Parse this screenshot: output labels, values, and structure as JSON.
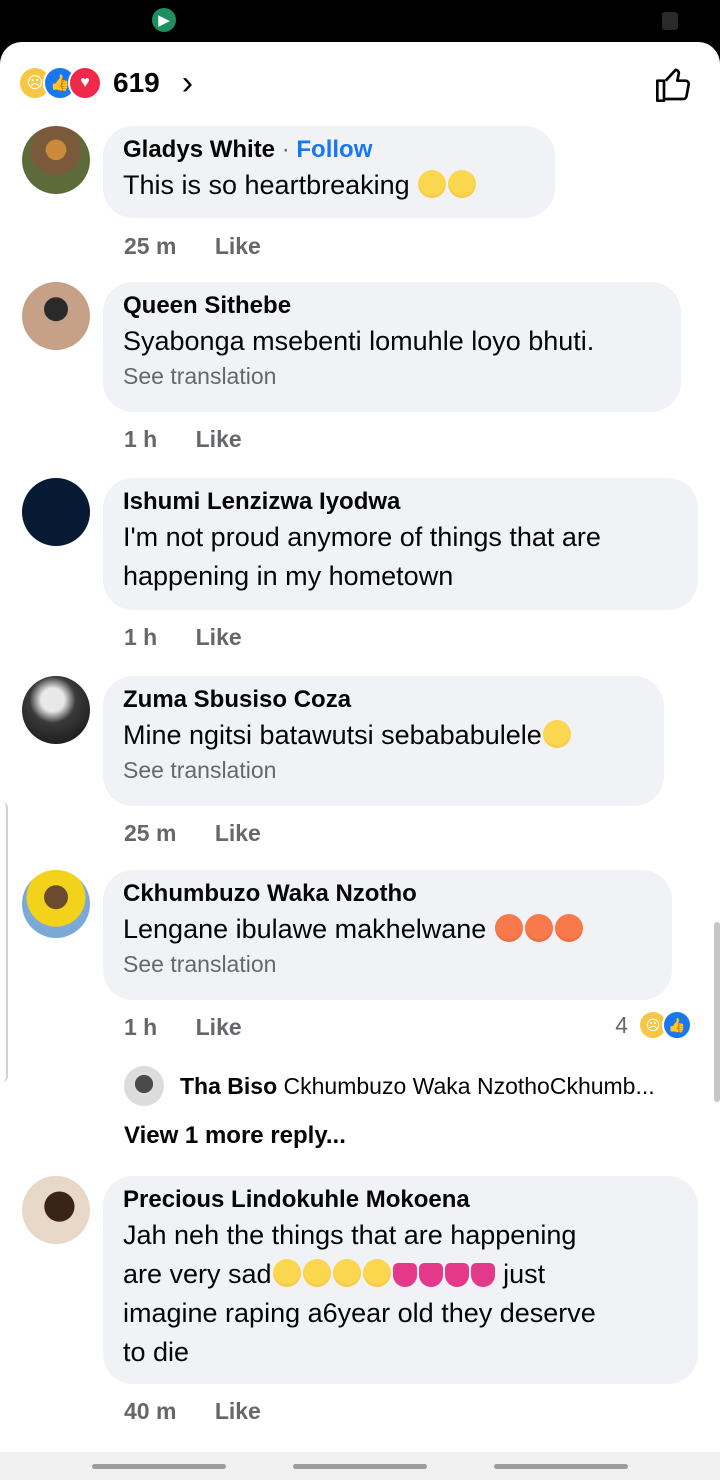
{
  "reactions": {
    "count": "619",
    "icons": [
      "sad-react-icon",
      "like-react-icon",
      "love-react-icon"
    ]
  },
  "comments": [
    {
      "author": "Gladys White",
      "follow": "Follow",
      "text": "This is so heartbreaking",
      "emoji": "loudly-crying-emoji x2",
      "time": "25 m",
      "like": "Like"
    },
    {
      "author": "Queen Sithebe",
      "text": "Syabonga msebenti lomuhle loyo bhuti.",
      "see_translation": "See translation",
      "time": "1 h",
      "like": "Like"
    },
    {
      "author": "Ishumi Lenzizwa Iyodwa",
      "text": "I'm not proud anymore of things that are happening in my hometown",
      "time": "1 h",
      "like": "Like"
    },
    {
      "author": "Zuma Sbusiso Coza",
      "text": "Mine ngitsi batawutsi sebababulele",
      "emoji": "angry-face-emoji",
      "see_translation": "See translation",
      "time": "25 m",
      "like": "Like"
    },
    {
      "author": "Ckhumbuzo Waka Nzotho",
      "text": "Lengane ibulawe makhelwane",
      "emoji": "pouting-face-emoji x3",
      "see_translation": "See translation",
      "time": "1 h",
      "like": "Like",
      "reaction_count": "4",
      "reply": {
        "author": "Tha Biso",
        "text": "Ckhumbuzo Waka NzothoCkhumb..."
      },
      "view_more": "View 1 more reply..."
    },
    {
      "author": "Precious Lindokuhle Mokoena",
      "text_1": "Jah neh the things that are happening",
      "text_2": "are very sad",
      "text_3": "just",
      "text_4": "imagine raping a6year old  they deserve",
      "text_5": "to die",
      "emoji": "sad-face-emoji x4, broken-heart-emoji x4",
      "time": "40 m",
      "like": "Like"
    }
  ]
}
